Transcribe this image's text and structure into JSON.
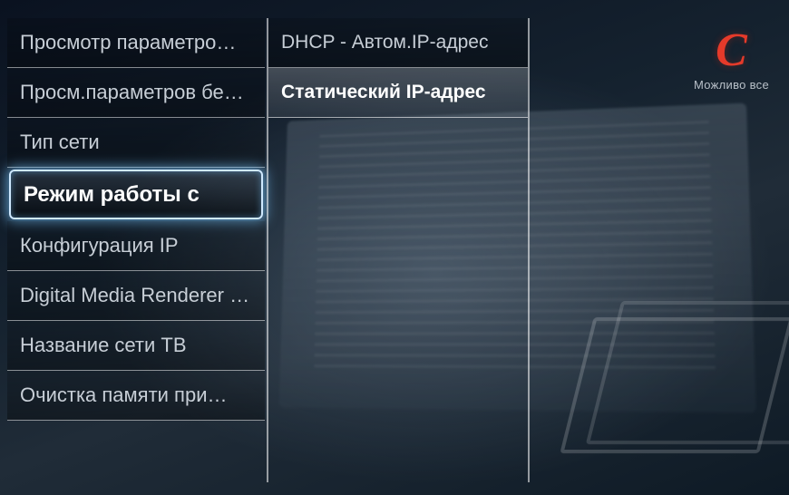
{
  "channel": {
    "logo_letter": "С",
    "tagline": "Можливо все"
  },
  "left_menu": {
    "items": [
      {
        "label": "Просмотр параметро…"
      },
      {
        "label": "Просм.параметров бе…"
      },
      {
        "label": "Тип сети"
      },
      {
        "label": "Режим работы с",
        "selected": true
      },
      {
        "label": "Конфигурация IP"
      },
      {
        "label": "Digital Media Renderer …"
      },
      {
        "label": "Название сети ТВ"
      },
      {
        "label": "Очистка памяти при…"
      }
    ]
  },
  "right_menu": {
    "items": [
      {
        "label": "DHCP - Автом.IP-адрес"
      },
      {
        "label": "Статический IP-адрес",
        "highlight": true
      }
    ]
  }
}
